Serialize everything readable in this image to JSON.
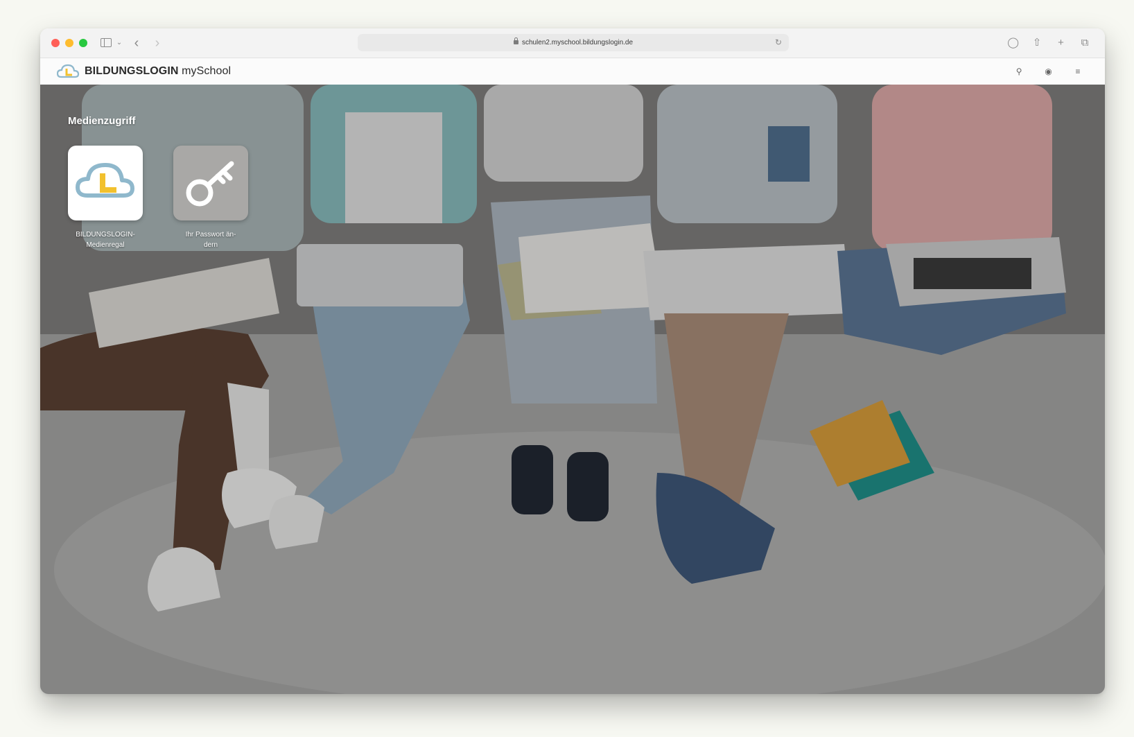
{
  "browser": {
    "url": "schulen2.myschool.bildungslogin.de"
  },
  "app": {
    "brand_bold": "BILDUNGSLOGIN",
    "brand_rest": " mySchool"
  },
  "section": {
    "title": "Medienzugriff"
  },
  "tiles": [
    {
      "label_line1": "BILDUNGSLOGIN-",
      "label_line2": "Medienregal",
      "icon": "cloud-logo-icon"
    },
    {
      "label_line1": "Ihr Passwort än-",
      "label_line2": "dern",
      "icon": "key-icon"
    }
  ],
  "colors": {
    "logo_blue": "#8fb8cc",
    "logo_yellow": "#f2c12e",
    "tile_grey": "#a9a8a6"
  }
}
